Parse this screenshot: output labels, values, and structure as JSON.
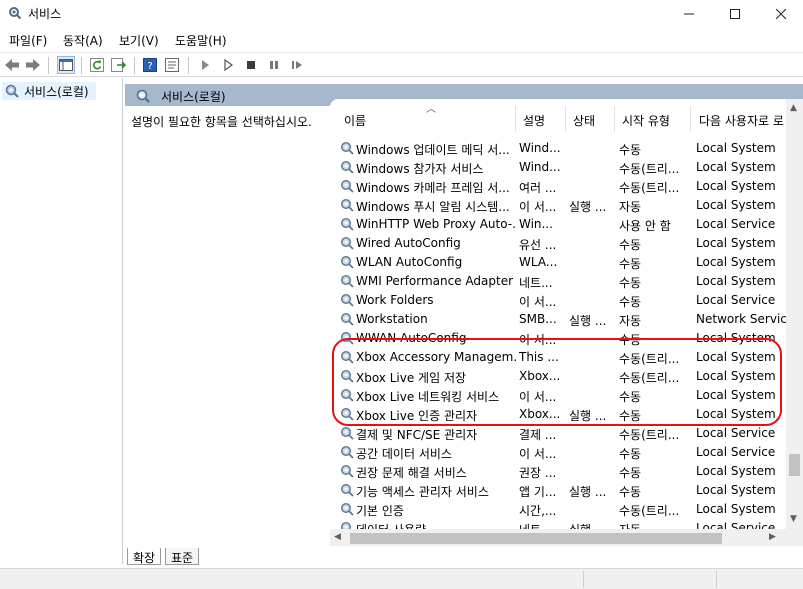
{
  "window": {
    "title": "서비스",
    "minimize": "—",
    "maximize": "☐",
    "close": "✕"
  },
  "menu": [
    "파일(F)",
    "동작(A)",
    "보기(V)",
    "도움말(H)"
  ],
  "toolbar_icons": [
    "back-arrow-icon",
    "forward-arrow-icon",
    "show-tree-icon",
    "refresh-icon",
    "export-list-icon",
    "help-icon",
    "properties-icon",
    "start-service-icon",
    "start-service-alt-icon",
    "stop-service-icon",
    "pause-service-icon",
    "restart-service-icon"
  ],
  "tree": {
    "item": "서비스(로컬)"
  },
  "pane": {
    "header": "서비스(로컬)",
    "description": "설명이 필요한 항목을 선택하십시오."
  },
  "columns": {
    "name": "이름",
    "desc": "설명",
    "status": "상태",
    "startup": "시작 유형",
    "logon": "다음 사용자로 로"
  },
  "services": [
    {
      "name": "Windows 업데이트 메딕 서...",
      "desc": "Wind...",
      "status": "",
      "startup": "수동",
      "logon": "Local System"
    },
    {
      "name": "Windows 참가자 서비스",
      "desc": "Wind...",
      "status": "",
      "startup": "수동(트리...",
      "logon": "Local System"
    },
    {
      "name": "Windows 카메라 프레임 서...",
      "desc": "여러 ...",
      "status": "",
      "startup": "수동(트리...",
      "logon": "Local System"
    },
    {
      "name": "Windows 푸시 알림 시스템...",
      "desc": "이 서...",
      "status": "실행 ...",
      "startup": "자동",
      "logon": "Local System"
    },
    {
      "name": "WinHTTP Web Proxy Auto-...",
      "desc": "Win...",
      "status": "",
      "startup": "사용 안 함",
      "logon": "Local Service"
    },
    {
      "name": "Wired AutoConfig",
      "desc": "유선 ...",
      "status": "",
      "startup": "수동",
      "logon": "Local System"
    },
    {
      "name": "WLAN AutoConfig",
      "desc": "WLA...",
      "status": "",
      "startup": "수동",
      "logon": "Local System"
    },
    {
      "name": "WMI Performance Adapter",
      "desc": "네트...",
      "status": "",
      "startup": "수동",
      "logon": "Local System"
    },
    {
      "name": "Work Folders",
      "desc": "이 서...",
      "status": "",
      "startup": "수동",
      "logon": "Local Service"
    },
    {
      "name": "Workstation",
      "desc": "SMB...",
      "status": "실행 ...",
      "startup": "자동",
      "logon": "Network Service"
    },
    {
      "name": "WWAN AutoConfig",
      "desc": "이 서...",
      "status": "",
      "startup": "수동",
      "logon": "Local System"
    },
    {
      "name": "Xbox Accessory Managem...",
      "desc": "This ...",
      "status": "",
      "startup": "수동(트리...",
      "logon": "Local System"
    },
    {
      "name": "Xbox Live 게임 저장",
      "desc": "Xbox...",
      "status": "",
      "startup": "수동(트리...",
      "logon": "Local System"
    },
    {
      "name": "Xbox Live 네트워킹 서비스",
      "desc": "이 서...",
      "status": "",
      "startup": "수동",
      "logon": "Local System"
    },
    {
      "name": "Xbox Live 인증 관리자",
      "desc": "Xbox...",
      "status": "실행 ...",
      "startup": "수동",
      "logon": "Local System"
    },
    {
      "name": "결제 및 NFC/SE 관리자",
      "desc": "결제 ...",
      "status": "",
      "startup": "수동(트리...",
      "logon": "Local Service"
    },
    {
      "name": "공간 데이터 서비스",
      "desc": "이 서...",
      "status": "",
      "startup": "수동",
      "logon": "Local Service"
    },
    {
      "name": "권장 문제 해결 서비스",
      "desc": "권장 ...",
      "status": "",
      "startup": "수동",
      "logon": "Local System"
    },
    {
      "name": "기능 액세스 관리자 서비스",
      "desc": "앱 기...",
      "status": "실행 ...",
      "startup": "수동",
      "logon": "Local System"
    },
    {
      "name": "기본 인증",
      "desc": "시간,...",
      "status": "",
      "startup": "수동(트리...",
      "logon": "Local System"
    },
    {
      "name": "데이터 사용량",
      "desc": "네트...",
      "status": "실행 ...",
      "startup": "자동",
      "logon": "Local Service"
    }
  ],
  "tabs": {
    "extended": "확장",
    "standard": "표준"
  },
  "colors": {
    "header_bg": "#a6b8cc",
    "highlight": "#e41313",
    "selection": "#e5f3ff"
  }
}
